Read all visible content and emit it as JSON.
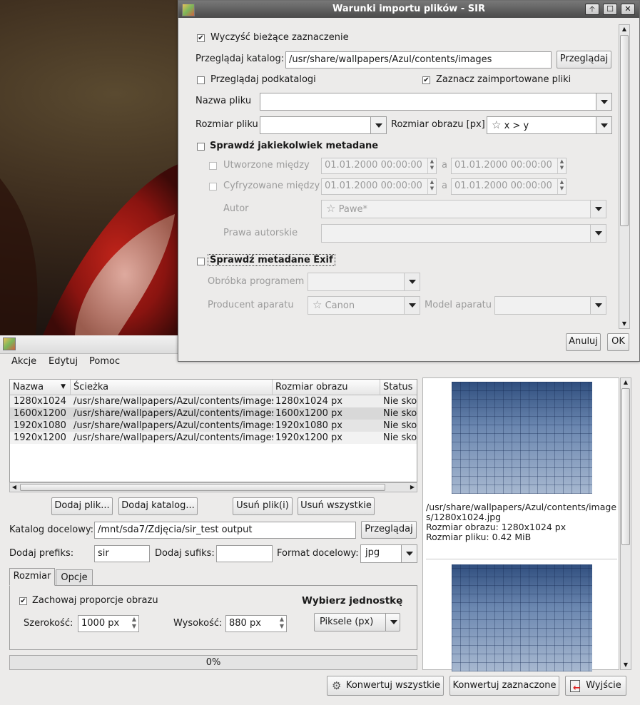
{
  "dialog": {
    "title": "Warunki importu plików - SIR",
    "clear_selection": "Wyczyść bieżące zaznaczenie",
    "browse_dir_label": "Przeglądaj katalog:",
    "browse_dir_value": "/usr/share/wallpapers/Azul/contents/images",
    "browse_button": "Przeglądaj",
    "browse_subdirs": "Przeglądaj podkatalogi",
    "select_imported": "Zaznacz zaimportowane pliki",
    "filename_label": "Nazwa pliku",
    "filesize_label": "Rozmiar pliku",
    "imagesize_label": "Rozmiar obrazu [px]",
    "imagesize_value": "x > y",
    "check_any_metadata": "Sprawdź jakiekolwiek metadane",
    "created_between": "Utworzone między",
    "digitized_between": "Cyfryzowane między",
    "date_value": "01.01.2000 00:00:00",
    "and_label": "a",
    "author_label": "Autor",
    "author_value": "Pawe*",
    "copyright_label": "Prawa autorskie",
    "check_exif": "Sprawdź metadane Exif",
    "software_label": "Obróbka programem",
    "manufacturer_label": "Producent aparatu",
    "manufacturer_value": "Canon",
    "model_label": "Model aparatu",
    "cancel": "Anuluj",
    "ok": "OK"
  },
  "menu": {
    "actions": "Akcje",
    "edit": "Edytuj",
    "help": "Pomoc"
  },
  "table": {
    "headers": [
      "Nazwa",
      "Ścieżka",
      "Rozmiar obrazu",
      "Status"
    ],
    "rows": [
      [
        "1280x1024",
        "/usr/share/wallpapers/Azul/contents/images",
        "1280x1024 px",
        "Nie skonwertowany"
      ],
      [
        "1600x1200",
        "/usr/share/wallpapers/Azul/contents/images",
        "1600x1200 px",
        "Nie skonwertowany"
      ],
      [
        "1920x1080",
        "/usr/share/wallpapers/Azul/contents/images",
        "1920x1080 px",
        "Nie skonwertowany"
      ],
      [
        "1920x1200",
        "/usr/share/wallpapers/Azul/contents/images",
        "1920x1200 px",
        "Nie skonwertowany"
      ]
    ]
  },
  "buttons": {
    "add_file": "Dodaj plik...",
    "add_dir": "Dodaj katalog...",
    "remove_files": "Usuń plik(i)",
    "remove_all": "Usuń wszystkie",
    "browse": "Przeglądaj",
    "convert_all": "Konwertuj wszystkie",
    "convert_selected": "Konwertuj zaznaczone",
    "exit": "Wyjście"
  },
  "output": {
    "dir_label": "Katalog docelowy:",
    "dir_value": "/mnt/sda7/Zdjęcia/sir_test output",
    "prefix_label": "Dodaj prefiks:",
    "prefix_value": "sir",
    "suffix_label": "Dodaj sufiks:",
    "suffix_value": "",
    "format_label": "Format docelowy:",
    "format_value": "jpg"
  },
  "tabs": {
    "size": "Rozmiar",
    "options": "Opcje"
  },
  "size": {
    "keep_ratio": "Zachowaj proporcje obrazu",
    "unit_title": "Wybierz jednostkę",
    "width_label": "Szerokość:",
    "width_value": "1000 px",
    "height_label": "Wysokość:",
    "height_value": "880 px",
    "unit_value": "Piksele (px)"
  },
  "progress": {
    "text": "0%",
    "value": 0
  },
  "preview": {
    "path": "/usr/share/wallpapers/Azul/contents/images/1280x1024.jpg",
    "image_size": "Rozmiar obrazu: 1280x1024 px",
    "file_size": "Rozmiar pliku: 0.42 MiB"
  }
}
